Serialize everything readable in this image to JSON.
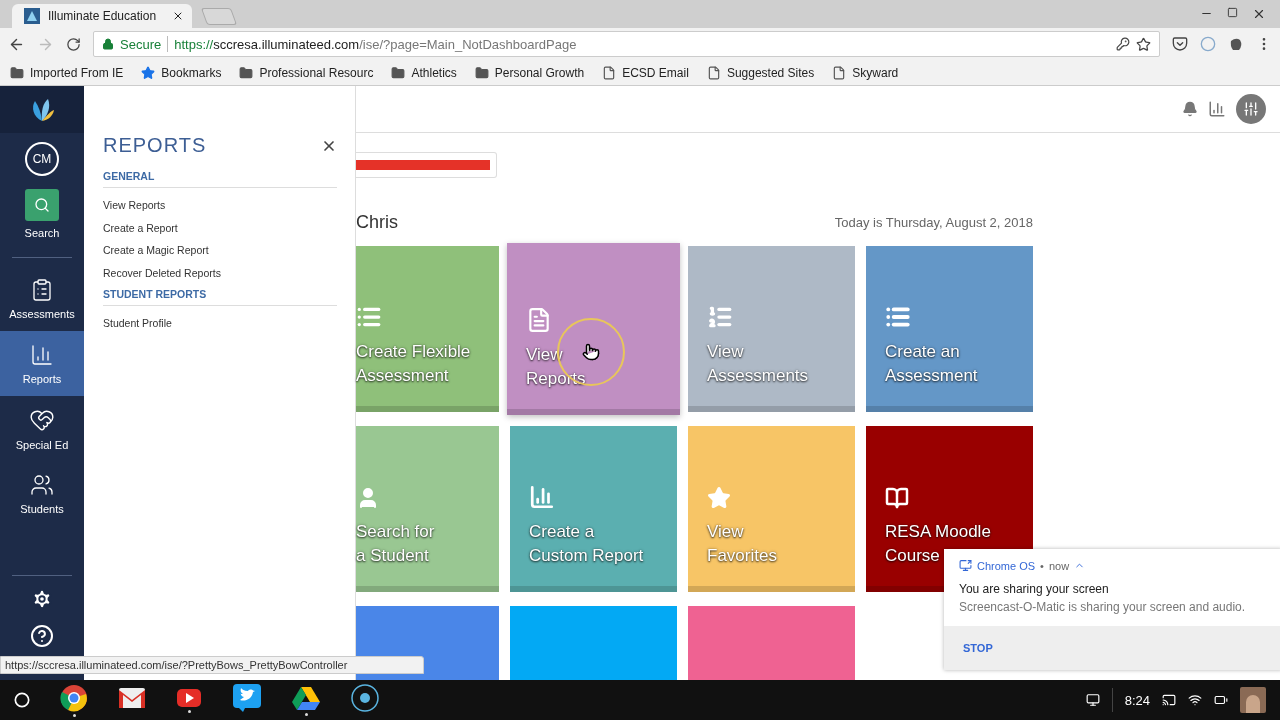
{
  "browser": {
    "tabs": [
      {
        "title": "Illuminate Education",
        "selected": true
      }
    ],
    "address": {
      "security": "Secure",
      "scheme": "https://",
      "host": "sccresa.illuminateed.com",
      "path": "/ise/?page=Main_NotDashboardPage"
    },
    "bookmarks": [
      {
        "label": "Imported From IE",
        "kind": "folder"
      },
      {
        "label": "Bookmarks",
        "kind": "star"
      },
      {
        "label": "Professional Resourc",
        "kind": "folder"
      },
      {
        "label": "Athletics",
        "kind": "folder"
      },
      {
        "label": "Personal Growth",
        "kind": "folder"
      },
      {
        "label": "ECSD Email",
        "kind": "page"
      },
      {
        "label": "Suggested Sites",
        "kind": "page"
      },
      {
        "label": "Skyward",
        "kind": "page"
      }
    ]
  },
  "sidebar": {
    "avatar": "CM",
    "search": "Search",
    "items": [
      {
        "label": "Assessments",
        "kind": "clipboard",
        "selected": false
      },
      {
        "label": "Reports",
        "kind": "chart",
        "selected": true
      },
      {
        "label": "Special Ed",
        "kind": "heart",
        "selected": false
      },
      {
        "label": "Students",
        "kind": "people",
        "selected": false
      }
    ]
  },
  "flyout": {
    "title": "REPORTS",
    "sections": [
      {
        "heading": "GENERAL",
        "items": [
          "View Reports",
          "Create a Report",
          "Create a Magic Report",
          "Recover Deleted Reports"
        ]
      },
      {
        "heading": "STUDENT REPORTS",
        "items": [
          "Student Profile"
        ]
      }
    ]
  },
  "greeting": "Chris",
  "date": "Today is Thursday, August 2, 2018",
  "tiles": [
    {
      "lines": [
        "Create Flexible",
        "Assessment"
      ],
      "kind": "form",
      "color": "#8fc07a",
      "raised": false
    },
    {
      "lines": [
        "View",
        "Reports"
      ],
      "kind": "document",
      "color": "#c08fc2",
      "raised": true
    },
    {
      "lines": [
        "View",
        "Assessments"
      ],
      "kind": "numbered",
      "color": "#aeb9c6",
      "raised": false
    },
    {
      "lines": [
        "Create an",
        "Assessment"
      ],
      "kind": "list",
      "color": "#6497c7",
      "raised": false
    },
    {
      "lines": [
        "Search for",
        "a Student"
      ],
      "kind": "person",
      "color": "#99c792",
      "raised": false
    },
    {
      "lines": [
        "Create a",
        "Custom Report"
      ],
      "kind": "chart",
      "color": "#5bafb0",
      "raised": false
    },
    {
      "lines": [
        "View",
        "Favorites"
      ],
      "kind": "star",
      "color": "#f7c566",
      "raised": false
    },
    {
      "lines": [
        "RESA Moodle",
        "Course"
      ],
      "kind": "book",
      "color": "#990000",
      "raised": false
    },
    {
      "kind": "none",
      "color": "#4a86e8",
      "raised": false
    },
    {
      "kind": "none",
      "color": "#03a9f4",
      "raised": false
    },
    {
      "kind": "none",
      "color": "#ef6292",
      "raised": false
    }
  ],
  "status_url": "https://sccresa.illuminateed.com/ise/?PrettyBows_PrettyBowController",
  "notification": {
    "source": "Chrome OS",
    "separator": "•",
    "time": "now",
    "title": "You are sharing your screen",
    "body": "Screencast-O-Matic is sharing your screen and audio.",
    "action": "STOP"
  },
  "shelf": {
    "apps": [
      {
        "kind": "browser",
        "running": true
      },
      {
        "kind": "mail",
        "running": false
      },
      {
        "kind": "video",
        "running": true
      },
      {
        "kind": "bird",
        "running": false
      },
      {
        "kind": "drive",
        "running": true
      },
      {
        "kind": "ring",
        "running": false
      }
    ],
    "time": "8:24"
  }
}
